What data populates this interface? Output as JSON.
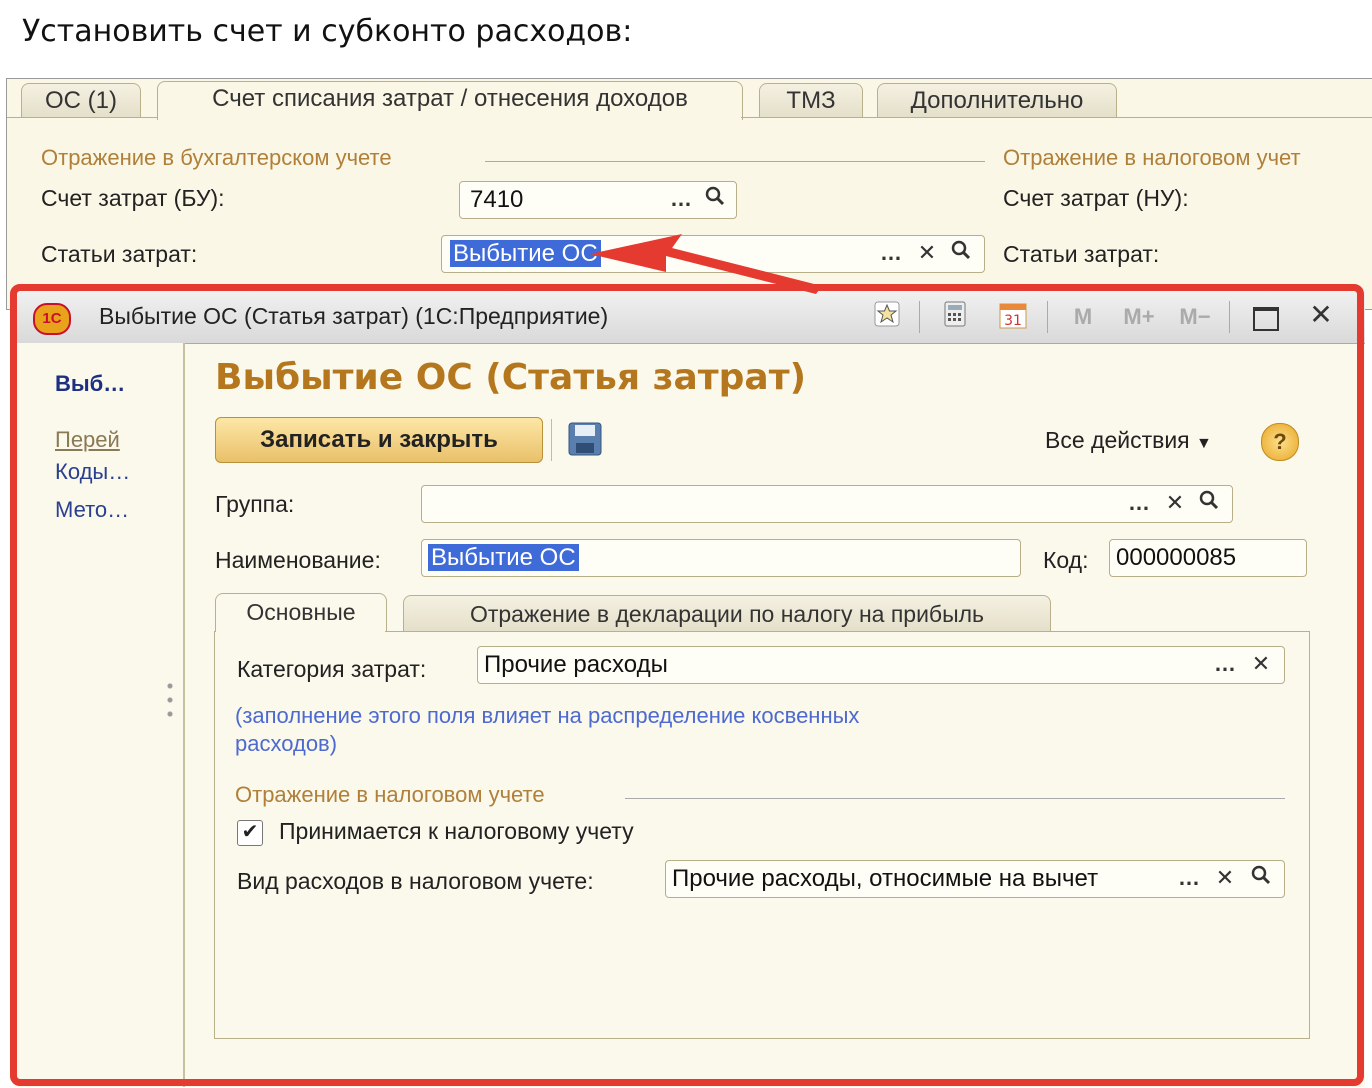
{
  "caption": "Установить счет и субконто расходов:",
  "bg_form": {
    "tabs": [
      "ОС (1)",
      "Счет списания затрат / отнесения доходов",
      "ТМЗ",
      "Дополнительно"
    ],
    "group_bu": "Отражение в бухгалтерском учете",
    "group_nu": "Отражение в налоговом учет",
    "account_bu_label": "Счет затрат (БУ):",
    "account_bu_value": "7410",
    "cost_items_label": "Статьи затрат:",
    "cost_items_value": "Выбытие ОС",
    "account_nu_label": "Счет затрат (НУ):",
    "cost_items_nu_label": "Статьи затрат:"
  },
  "window": {
    "title": "Выбытие ОС (Статья затрат)  (1С:Предприятие)",
    "titlebar_icons": {
      "logo": "1С",
      "calendar_day": "31",
      "m": "M",
      "m_plus": "M+",
      "m_minus": "M−"
    },
    "nav": {
      "item_main": "Выб…",
      "item_1": "Перей",
      "item_2": "Коды…",
      "item_3": "Мето…"
    },
    "heading": "Выбытие ОС (Статья затрат)",
    "save_close_label": "Записать и закрыть",
    "all_actions_label": "Все действия",
    "help_label": "?",
    "group_label": "Группа:",
    "group_value": "",
    "name_label": "Наименование:",
    "name_value": "Выбытие ОС",
    "code_label": "Код:",
    "code_value": "000000085",
    "tabs": [
      "Основные",
      "Отражение в декларации по налогу на прибыль"
    ],
    "category_label": "Категория затрат:",
    "category_value": "Прочие расходы",
    "hint_line1": "(заполнение этого поля влияет на распределение косвенных",
    "hint_line2": "расходов)",
    "tax_group_title": "Отражение в налоговом учете",
    "tax_check_label": "Принимается к налоговому учету",
    "tax_check_checked": true,
    "expense_type_label": "Вид расходов в налоговом учете:",
    "expense_type_value": "Прочие расходы, относимые на вычет"
  },
  "colors": {
    "highlight": "#e53a30",
    "heading": "#b5771d",
    "selection": "#3f6bd8"
  }
}
